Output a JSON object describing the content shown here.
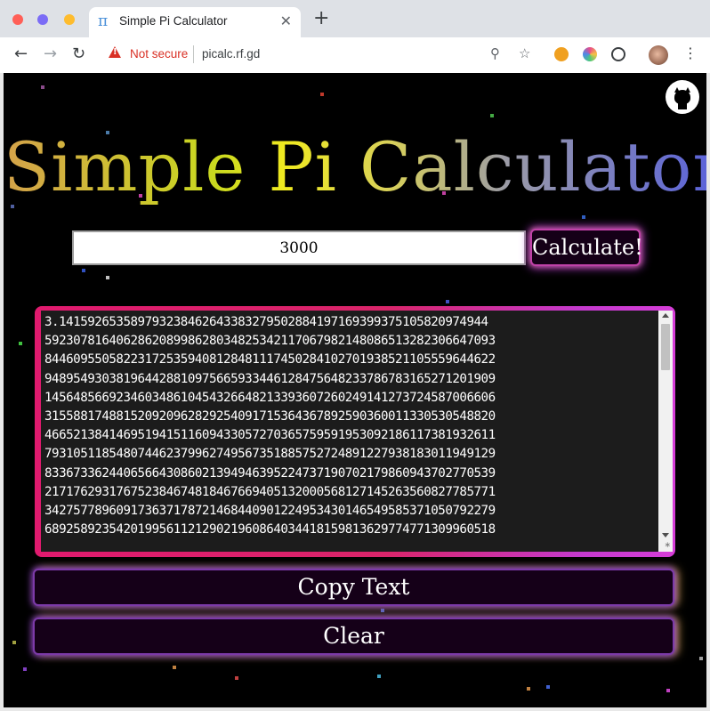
{
  "browser": {
    "tab_icon": "π",
    "tab_title": "Simple Pi Calculator",
    "tab_close": "✕",
    "new_tab": "+",
    "security_label": "Not secure",
    "url": "picalc.rf.gd"
  },
  "app": {
    "title": "Simple Pi Calculator",
    "digits_input_value": "3000",
    "calculate_label": "Calculate!",
    "output_lines": [
      "3.141592653589793238462643383279502884197169399375105820974944",
      "592307816406286208998628034825342117067982148086513282306647093",
      "844609550582231725359408128481117450284102701938521105559644622",
      "948954930381964428810975665933446128475648233786783165271201909",
      "145648566923460348610454326648213393607260249141273724587006606",
      "315588174881520920962829254091715364367892590360011330530548820",
      "466521384146951941511609433057270365759591953092186117381932611",
      "793105118548074462379962749567351885752724891227938183011949129",
      "833673362440656643086021394946395224737190702179860943702770539",
      "217176293176752384674818467669405132000568127145263560827785771",
      "342757789609173637178721468440901224953430146549585371050792279",
      "689258923542019956112129021960864034418159813629774771309960518"
    ],
    "copy_label": "Copy Text",
    "clear_label": "Clear"
  },
  "colors": {
    "background": "#000000",
    "title_gradient_start": "#d4a24a",
    "title_gradient_end": "#5c64d8",
    "output_border": "#e01a6e",
    "button_glow": "#b33ad0"
  },
  "icons": [
    "back-icon",
    "forward-icon",
    "reload-icon",
    "warning-icon",
    "zoom-icon",
    "bookmark-star-icon",
    "extension-icon",
    "profile-avatar",
    "menu-icon",
    "github-icon"
  ]
}
